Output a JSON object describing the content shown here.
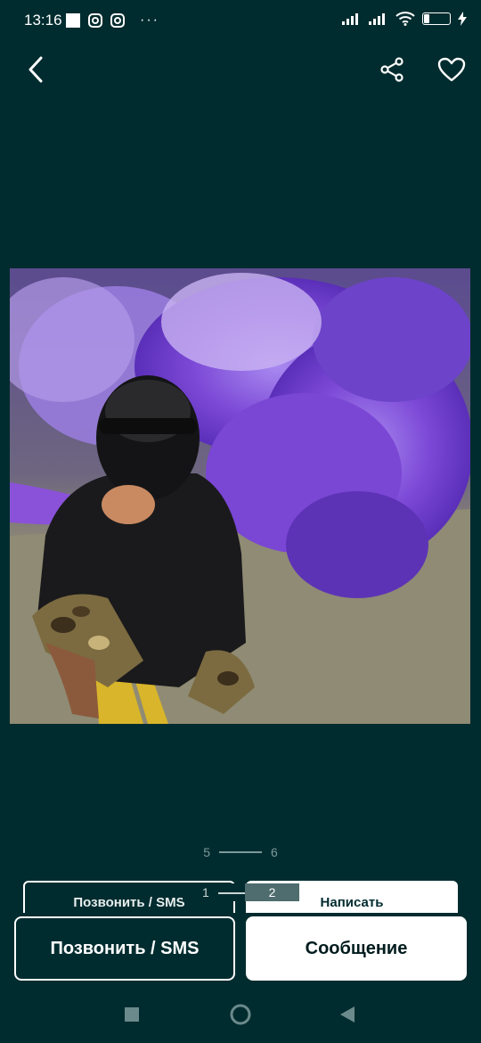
{
  "status_bar": {
    "time": "13:16",
    "battery_level": 24,
    "battery_label": "24",
    "icons": [
      "gallery-icon",
      "instagram-icon",
      "instagram-icon",
      "more-dots-icon",
      "signal-icon",
      "signal-icon",
      "wifi-icon",
      "battery-icon",
      "charging-icon"
    ]
  },
  "nav": {
    "back_icon": "chevron-left-icon",
    "share_icon": "share-icon",
    "favorite_icon": "heart-icon"
  },
  "gallery": {
    "pager_current": "5",
    "pager_total": "6"
  },
  "ghost_bar": {
    "call_label": "Позвонить / SMS",
    "write_label": "Написать",
    "mini_pager_current": "1",
    "mini_pager_next": "2"
  },
  "actions": {
    "call_label": "Позвонить / SMS",
    "message_label": "Сообщение"
  },
  "colors": {
    "background": "#012c2f",
    "smoke": "#7b48d6",
    "button_light": "#ffffff"
  }
}
